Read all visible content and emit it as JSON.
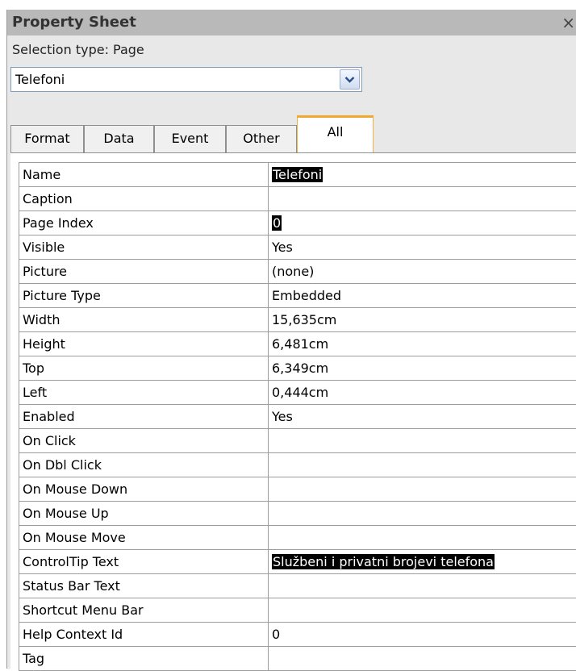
{
  "panel": {
    "title": "Property Sheet",
    "close_glyph": "×",
    "selection_label": "Selection type:  Page",
    "object_select": {
      "value": "Telefoni"
    }
  },
  "tabs": [
    {
      "label": "Format",
      "active": false
    },
    {
      "label": "Data",
      "active": false
    },
    {
      "label": "Event",
      "active": false
    },
    {
      "label": "Other",
      "active": false
    },
    {
      "label": "All",
      "active": true
    }
  ],
  "properties": [
    {
      "name": "Name",
      "value": "Telefoni",
      "selected": true
    },
    {
      "name": "Caption",
      "value": ""
    },
    {
      "name": "Page Index",
      "value": "0",
      "selected": true
    },
    {
      "name": "Visible",
      "value": "Yes"
    },
    {
      "name": "Picture",
      "value": "(none)"
    },
    {
      "name": "Picture Type",
      "value": "Embedded"
    },
    {
      "name": "Width",
      "value": "15,635cm"
    },
    {
      "name": "Height",
      "value": "6,481cm"
    },
    {
      "name": "Top",
      "value": "6,349cm"
    },
    {
      "name": "Left",
      "value": "0,444cm"
    },
    {
      "name": "Enabled",
      "value": "Yes"
    },
    {
      "name": "On Click",
      "value": ""
    },
    {
      "name": "On Dbl Click",
      "value": ""
    },
    {
      "name": "On Mouse Down",
      "value": ""
    },
    {
      "name": "On Mouse Up",
      "value": ""
    },
    {
      "name": "On Mouse Move",
      "value": ""
    },
    {
      "name": "ControlTip Text",
      "value": "Službeni i privatni brojevi telefona",
      "selected": true
    },
    {
      "name": "Status Bar Text",
      "value": ""
    },
    {
      "name": "Shortcut Menu Bar",
      "value": ""
    },
    {
      "name": "Help Context Id",
      "value": "0"
    },
    {
      "name": "Tag",
      "value": ""
    }
  ],
  "colors": {
    "title_bar": "#b9b9b9",
    "pane_bg": "#e8e8e8",
    "active_tab_accent": "#f0a830",
    "selection_bg": "#000000"
  }
}
